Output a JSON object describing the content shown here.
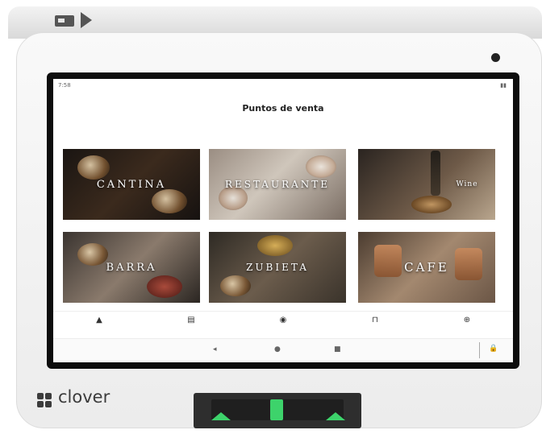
{
  "brand": {
    "name": "clover"
  },
  "screen": {
    "status_time": "7:58",
    "title": "Puntos de venta",
    "tiles": [
      {
        "label": "CANTINA"
      },
      {
        "label": "RESTAURANTE"
      },
      {
        "label": "Wine"
      },
      {
        "label": "BARRA"
      },
      {
        "label": "ZUBIETA"
      },
      {
        "label": "CAFE"
      }
    ],
    "nav": [
      {
        "icon": "▲"
      },
      {
        "icon": "▤"
      },
      {
        "icon": "◉"
      },
      {
        "icon": "⊓"
      },
      {
        "icon": "⊕"
      }
    ],
    "system_bar": {
      "back": "◂",
      "home": "●",
      "recent": "■",
      "lock": "🔒"
    }
  },
  "colors": {
    "reader_accent": "#3dd36b",
    "bezel": "#0d0d0d",
    "device": "#f3f3f3"
  }
}
